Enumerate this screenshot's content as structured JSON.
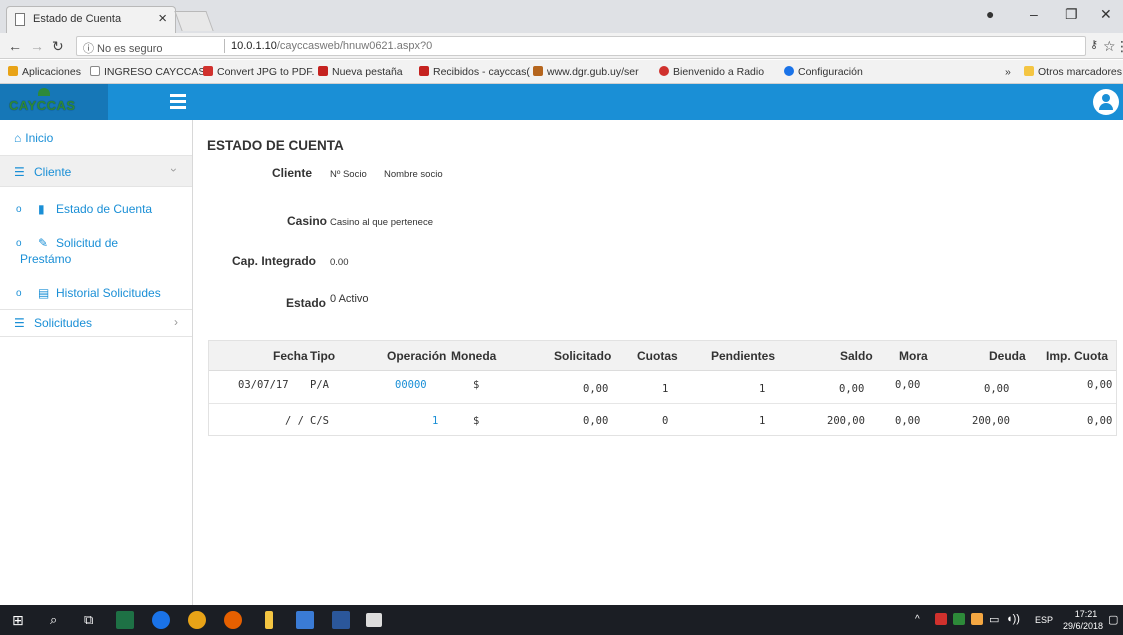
{
  "browser": {
    "tab_title": "Estado de Cuenta",
    "tab_close": "×",
    "security": "ⓘ No es seguro",
    "url_host": "10.0.1.10",
    "url_path": "/cayccasweb/hnuw0621.aspx?0",
    "bookmarks": [
      {
        "label": "Aplicaciones",
        "color": "#e8a317"
      },
      {
        "label": "INGRESO CAYCCAS",
        "color": "#cccccc"
      },
      {
        "label": "Convert JPG to PDF.",
        "color": "#d0312d"
      },
      {
        "label": "Nueva pestaña",
        "color": "#c5221f"
      },
      {
        "label": "Recibidos - cayccas(",
        "color": "#c5221f"
      },
      {
        "label": "www.dgr.gub.uy/ser",
        "color": "#b5651d"
      },
      {
        "label": "Bienvenido a Radio",
        "color": "#d0312d"
      },
      {
        "label": "Configuración",
        "color": "#1a73e8"
      }
    ],
    "bookmarks_more": "»",
    "other_bookmarks": "Otros marcadores"
  },
  "app": {
    "logo": "CAYCCAS",
    "sidebar": {
      "inicio": "Inicio",
      "cliente": "Cliente",
      "cliente_chevron": "›",
      "sub_items": [
        "Estado de Cuenta",
        "Solicitud de",
        "Prestámo",
        "Historial Solicitudes"
      ],
      "solicitudes": "Solicitudes",
      "solicitudes_chevron": "›"
    },
    "page_title": "ESTADO DE CUENTA",
    "fields": {
      "cliente_label": "Cliente",
      "nro_socio": "Nº Socio",
      "nombre_socio": "Nombre socio",
      "casino_label": "Casino",
      "casino_value": "Casino al que pertenece",
      "cap_label": "Cap. Integrado",
      "cap_value": "0.00",
      "estado_label": "Estado",
      "estado_value": "0 Activo"
    },
    "table": {
      "headers": [
        "Fecha",
        "Tipo",
        "Operación",
        "Moneda",
        "Solicitado",
        "Cuotas",
        "Pendientes",
        "Saldo",
        "Mora",
        "Deuda",
        "Imp. Cuota"
      ],
      "rows": [
        [
          "03/07/17",
          "P/A",
          "00000",
          "$",
          "0,00",
          "1",
          "1",
          "0,00",
          "0,00",
          "0,00",
          "0,00"
        ],
        [
          "/ /",
          "C/S",
          "1",
          "$",
          "0,00",
          "0",
          "1",
          "200,00",
          "0,00",
          "200,00",
          "0,00"
        ]
      ]
    }
  },
  "taskbar": {
    "lang": "ESP",
    "time": "17:21",
    "date": "29/6/2018"
  }
}
